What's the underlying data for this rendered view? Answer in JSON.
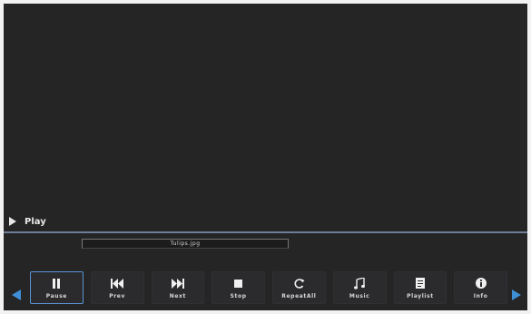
{
  "status": {
    "state": "Play",
    "icon": "play-icon"
  },
  "file": {
    "name": "Tulips.jpg"
  },
  "controls": [
    {
      "label": "Pause",
      "icon": "pause-icon",
      "selected": true
    },
    {
      "label": "Prev",
      "icon": "prev-icon"
    },
    {
      "label": "Next",
      "icon": "next-icon"
    },
    {
      "label": "Stop",
      "icon": "stop-icon"
    },
    {
      "label": "RepeatAll",
      "icon": "repeat-icon"
    },
    {
      "label": "Music",
      "icon": "music-icon"
    },
    {
      "label": "Playlist",
      "icon": "playlist-icon"
    },
    {
      "label": "Info",
      "icon": "info-icon"
    }
  ],
  "colors": {
    "background": "#252526",
    "accent": "#3f8fd6",
    "divider": "#6f7d96",
    "text": "#e2e2e2"
  }
}
